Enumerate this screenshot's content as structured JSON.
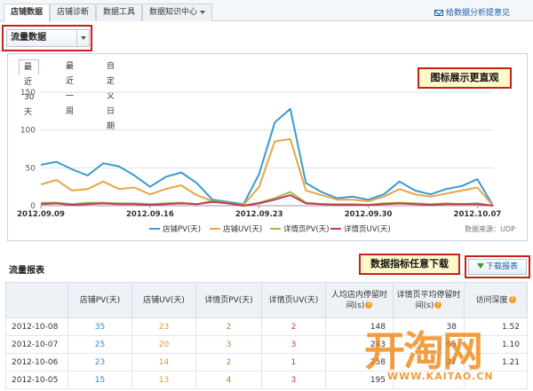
{
  "tabs": [
    {
      "label": "店铺数据",
      "active": true
    },
    {
      "label": "店铺诊断",
      "active": false
    },
    {
      "label": "数据工具",
      "active": false
    },
    {
      "label": "数据知识中心",
      "active": false,
      "dropdown": true
    }
  ],
  "feedback_link": "给数据分析提意见",
  "metric_select": {
    "value": "流量数据"
  },
  "range_tabs": [
    "最近30天",
    "最近一周",
    "自定义日期"
  ],
  "annotations": {
    "chart_note": "图标展示更直观",
    "download_note": "数据指标任意下载"
  },
  "chart_data": {
    "type": "line",
    "x": [
      "2012.09.09",
      "2012.09.10",
      "2012.09.11",
      "2012.09.12",
      "2012.09.13",
      "2012.09.14",
      "2012.09.15",
      "2012.09.16",
      "2012.09.17",
      "2012.09.18",
      "2012.09.19",
      "2012.09.20",
      "2012.09.21",
      "2012.09.22",
      "2012.09.23",
      "2012.09.24",
      "2012.09.25",
      "2012.09.26",
      "2012.09.27",
      "2012.09.28",
      "2012.09.29",
      "2012.09.30",
      "2012.10.01",
      "2012.10.02",
      "2012.10.03",
      "2012.10.04",
      "2012.10.05",
      "2012.10.06",
      "2012.10.07",
      "2012.10.08"
    ],
    "x_tick_labels": [
      "2012.09.09",
      "2012.09.16",
      "2012.09.23",
      "2012.09.30",
      "2012.10.07"
    ],
    "y_ticks": [
      0,
      50,
      100,
      150
    ],
    "ylim": [
      0,
      150
    ],
    "series": [
      {
        "name": "店铺PV(天)",
        "color": "#3a9ad0",
        "values": [
          54,
          58,
          48,
          40,
          56,
          52,
          40,
          25,
          38,
          44,
          30,
          8,
          5,
          2,
          42,
          110,
          128,
          30,
          18,
          10,
          12,
          8,
          15,
          32,
          20,
          15,
          22,
          26,
          35,
          0
        ]
      },
      {
        "name": "店铺UV(天)",
        "color": "#e6a646",
        "values": [
          28,
          34,
          20,
          22,
          32,
          22,
          24,
          15,
          22,
          27,
          14,
          6,
          3,
          1,
          25,
          85,
          88,
          20,
          14,
          8,
          8,
          6,
          12,
          22,
          15,
          12,
          16,
          20,
          24,
          0
        ]
      },
      {
        "name": "详情页PV(天)",
        "color": "#a6b74a",
        "values": [
          4,
          4,
          2,
          4,
          4,
          3,
          3,
          2,
          3,
          4,
          2,
          6,
          4,
          0,
          4,
          10,
          18,
          4,
          2,
          2,
          2,
          1,
          3,
          4,
          3,
          2,
          3,
          2,
          3,
          0
        ]
      },
      {
        "name": "详情页UV(天)",
        "color": "#c23a5a",
        "values": [
          2,
          3,
          1,
          2,
          3,
          2,
          2,
          1,
          2,
          3,
          2,
          5,
          3,
          0,
          3,
          8,
          14,
          3,
          2,
          1,
          1,
          1,
          2,
          3,
          2,
          1,
          2,
          2,
          2,
          0
        ]
      }
    ],
    "source": "数据来源：UDP"
  },
  "report": {
    "title": "流量报表",
    "download_label": "下载报表",
    "columns": [
      "",
      "店铺PV(天)",
      "店铺UV(天)",
      "详情页PV(天)",
      "详情页UV(天)",
      "人均店内停留时间(s)",
      "详情页平均停留时间(s)",
      "访问深度"
    ],
    "rows": [
      {
        "date": "2012-10-08",
        "shop_pv": "35",
        "shop_uv": "23",
        "detail_pv": "2",
        "detail_uv": "2",
        "avg_stay": "148",
        "detail_stay": "38",
        "depth": "1.52"
      },
      {
        "date": "2012-10-07",
        "shop_pv": "25",
        "shop_uv": "20",
        "detail_pv": "3",
        "detail_uv": "3",
        "avg_stay": "243",
        "detail_stay": "65",
        "depth": "1.10"
      },
      {
        "date": "2012-10-06",
        "shop_pv": "23",
        "shop_uv": "14",
        "detail_pv": "2",
        "detail_uv": "1",
        "avg_stay": "258",
        "detail_stay": "27",
        "depth": "1.21"
      },
      {
        "date": "2012-10-05",
        "shop_pv": "15",
        "shop_uv": "13",
        "detail_pv": "4",
        "detail_uv": "3",
        "avg_stay": "195",
        "detail_stay": "",
        "depth": ""
      }
    ]
  },
  "watermark": {
    "logo": "开淘网",
    "url": "WWW.KAITAO.CN"
  }
}
